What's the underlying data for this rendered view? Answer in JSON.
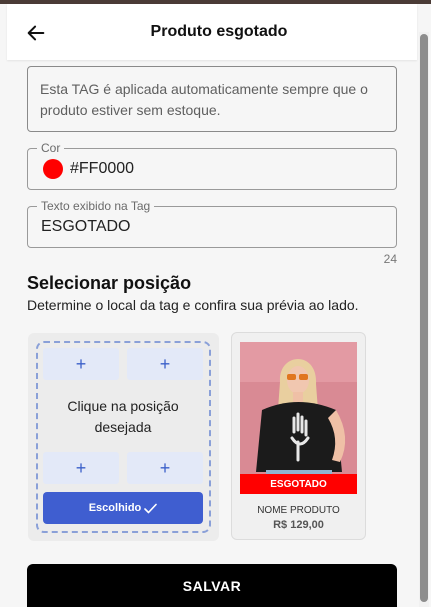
{
  "header": {
    "title": "Produto esgotado",
    "back_icon": "arrow-left-icon"
  },
  "info": {
    "text": "Esta TAG é aplicada automaticamente sempre que o produto estiver sem estoque."
  },
  "color_field": {
    "label": "Cor",
    "value": "#FF0000",
    "swatch_color": "#FF0000"
  },
  "tag_text_field": {
    "label": "Texto exibido na Tag",
    "value": "ESGOTADO",
    "counter": "24"
  },
  "position_section": {
    "title": "Selecionar posição",
    "subtitle": "Determine o local da tag e confira sua prévia ao lado.",
    "plus_symbol": "+",
    "center_hint": "Clique na posição desejada",
    "chosen_label": "Escolhido",
    "chosen_icon": "check-icon"
  },
  "preview": {
    "tag_label": "ESGOTADO",
    "product_name": "NOME PRODUTO",
    "product_price": "R$ 129,00"
  },
  "footer": {
    "save_label": "SALVAR"
  },
  "colors": {
    "accent": "#3F5ED0",
    "tag": "#FF0000",
    "position_button": "#E3E9F8",
    "save_button": "#000000"
  }
}
